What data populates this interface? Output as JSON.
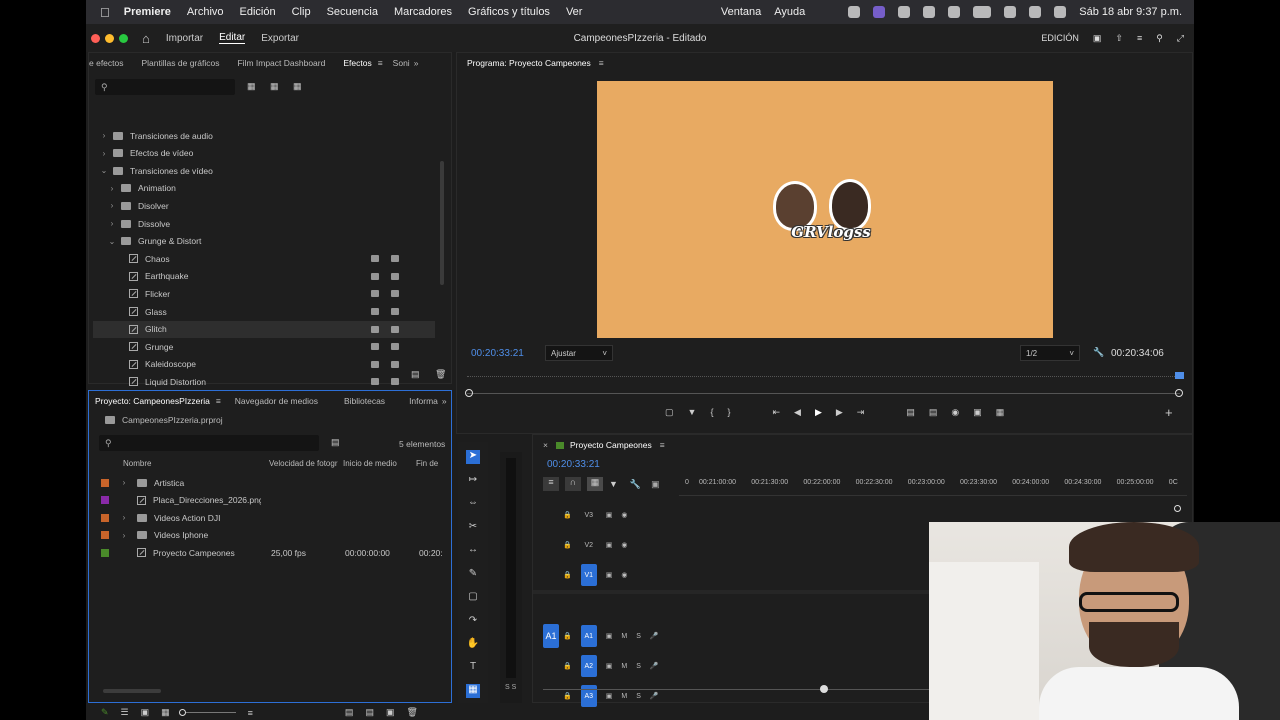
{
  "menubar": {
    "app": "Premiere",
    "items": [
      "Archivo",
      "Edición",
      "Clip",
      "Secuencia",
      "Marcadores",
      "Gráficos y títulos",
      "Ver"
    ],
    "right_items": [
      "Ventana",
      "Ayuda"
    ],
    "clock": "Sáb 18 abr 9:37 p.m."
  },
  "titlebar": {
    "nav": [
      "Importar",
      "Editar",
      "Exportar"
    ],
    "active_nav": "Editar",
    "doc_title": "CampeonesPIzzeria - Editado",
    "workspace": "EDICIÓN"
  },
  "effects": {
    "tabs": [
      "e efectos",
      "Plantillas de gráficos",
      "Film Impact Dashboard",
      "Efectos",
      "Soni"
    ],
    "active_tab": "Efectos",
    "tree": [
      {
        "label": "Transiciones de audio",
        "kind": "folder",
        "level": 0,
        "expanded": false
      },
      {
        "label": "Efectos de vídeo",
        "kind": "folder",
        "level": 0,
        "expanded": false
      },
      {
        "label": "Transiciones de vídeo",
        "kind": "folder",
        "level": 0,
        "expanded": true
      },
      {
        "label": "Animation",
        "kind": "folder",
        "level": 1,
        "expanded": false
      },
      {
        "label": "Disolver",
        "kind": "folder",
        "level": 1,
        "expanded": false
      },
      {
        "label": "Dissolve",
        "kind": "folder",
        "level": 1,
        "expanded": false
      },
      {
        "label": "Grunge & Distort",
        "kind": "folder",
        "level": 1,
        "expanded": true
      },
      {
        "label": "Chaos",
        "kind": "effect",
        "level": 2
      },
      {
        "label": "Earthquake",
        "kind": "effect",
        "level": 2
      },
      {
        "label": "Flicker",
        "kind": "effect",
        "level": 2
      },
      {
        "label": "Glass",
        "kind": "effect",
        "level": 2
      },
      {
        "label": "Glitch",
        "kind": "effect",
        "level": 2,
        "selected": true
      },
      {
        "label": "Grunge",
        "kind": "effect",
        "level": 2
      },
      {
        "label": "Kaleidoscope",
        "kind": "effect",
        "level": 2
      },
      {
        "label": "Liquid Distortion",
        "kind": "effect",
        "level": 2
      }
    ]
  },
  "program": {
    "tab": "Programa: Proyecto Campeones",
    "timecode": "00:20:33:21",
    "fit": "Ajustar",
    "resolution": "1/2",
    "duration": "00:20:34:06",
    "logo_text": "GRVlogss",
    "bg_color": "#e8aa62"
  },
  "project": {
    "tabs": [
      "Proyecto: CampeonesPIzzeria",
      "Navegador de medios",
      "Bibliotecas",
      "Informa"
    ],
    "file": "CampeonesPIzzeria.prproj",
    "count": "5 elementos",
    "columns": [
      "Nombre",
      "Velocidad de fotogr",
      "Inicio de medio",
      "Fin de"
    ],
    "items": [
      {
        "name": "Artistica",
        "type": "bin",
        "color": "#c8642a",
        "fps": "",
        "start": "",
        "end": ""
      },
      {
        "name": "Placa_Direcciones_2026.png",
        "type": "image",
        "color": "#8a2aa8",
        "fps": "",
        "start": "",
        "end": ""
      },
      {
        "name": "Videos Action DJI",
        "type": "bin",
        "color": "#c8642a",
        "fps": "",
        "start": "",
        "end": ""
      },
      {
        "name": "Videos Iphone",
        "type": "bin",
        "color": "#c8642a",
        "fps": "",
        "start": "",
        "end": ""
      },
      {
        "name": "Proyecto Campeones",
        "type": "sequence",
        "color": "#4a8a2a",
        "fps": "25,00 fps",
        "start": "00:00:00:00",
        "end": "00:20:"
      }
    ]
  },
  "timeline": {
    "tab": "Proyecto Campeones",
    "timecode": "00:20:33:21",
    "ruler": [
      "0",
      "00:21:00:00",
      "00:21:30:00",
      "00:22:00:00",
      "00:22:30:00",
      "00:23:00:00",
      "00:23:30:00",
      "00:24:00:00",
      "00:24:30:00",
      "00:25:00:00",
      "0C"
    ],
    "video_tracks": [
      "V3",
      "V2",
      "V1"
    ],
    "audio_tracks": [
      "A1",
      "A2",
      "A3"
    ],
    "source_patch": "A1",
    "meter_label": "S S"
  },
  "icons": {
    "search": "search-icon",
    "home": "home-icon",
    "play": "play-icon",
    "wrench": "wrench-icon",
    "eye": "eye-icon",
    "lock": "lock-icon",
    "mic": "mic-icon"
  },
  "colors": {
    "accent": "#2b6fd6",
    "timecode": "#4f8ee8"
  }
}
